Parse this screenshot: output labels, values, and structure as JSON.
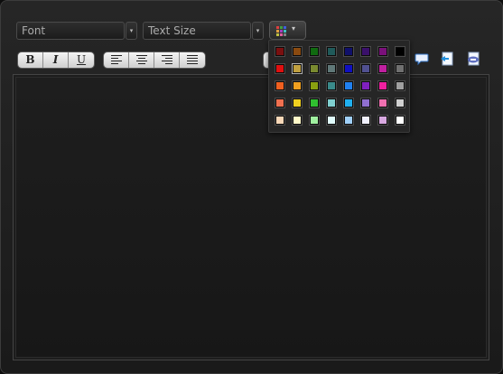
{
  "toolbar": {
    "font_select": {
      "value": "Font",
      "arrow": "▾"
    },
    "size_select": {
      "value": "Text Size",
      "arrow": "▾"
    },
    "color_button": {
      "icon": "color-grid-icon",
      "caret": "▾"
    },
    "format_buttons": [
      {
        "name": "bold",
        "label": "B"
      },
      {
        "name": "italic",
        "label": "I"
      },
      {
        "name": "underline",
        "label": "U"
      }
    ],
    "align_buttons": [
      {
        "name": "align-left"
      },
      {
        "name": "align-center"
      },
      {
        "name": "align-right"
      },
      {
        "name": "align-justify"
      }
    ],
    "extra_icons": [
      "speech-bubble-icon",
      "insert-link-icon",
      "php-icon"
    ]
  },
  "palette": {
    "selected": "#c0a040",
    "rows": [
      [
        "#7a1010",
        "#8a4a10",
        "#106a10",
        "#205a5a",
        "#10106a",
        "#3a106a",
        "#7a107a",
        "#000000"
      ],
      [
        "#e01010",
        "#c0a040",
        "#7a8a30",
        "#607878",
        "#1010c0",
        "#505090",
        "#c020a0",
        "#707070"
      ],
      [
        "#f06020",
        "#f0a020",
        "#8aa010",
        "#3a8a8a",
        "#2080f0",
        "#8020c0",
        "#f020a0",
        "#a0a0a0"
      ],
      [
        "#f07050",
        "#f0d020",
        "#30c030",
        "#80d0d0",
        "#20b0f0",
        "#9070d0",
        "#f070b0",
        "#d0d0d0"
      ],
      [
        "#f8d8b8",
        "#fff8c8",
        "#a0f0a0",
        "#e0fcfc",
        "#a0d0f8",
        "#f0f0fc",
        "#d8a8e0",
        "#ffffff"
      ]
    ]
  },
  "colors": {
    "background": "#0d0d0d",
    "frame": "#222222",
    "editor": "#181818"
  }
}
